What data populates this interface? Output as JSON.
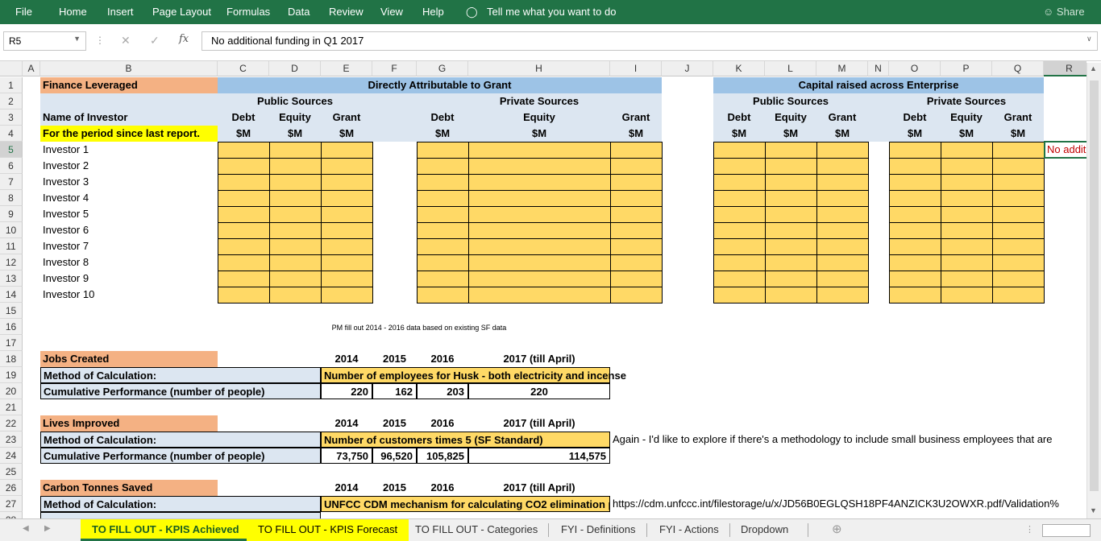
{
  "ribbon": {
    "menu": [
      "File",
      "Home",
      "Insert",
      "Page Layout",
      "Formulas",
      "Data",
      "Review",
      "View",
      "Help"
    ],
    "tell_me": "Tell me what you want to do",
    "share": "Share"
  },
  "formula": {
    "name_box": "R5",
    "value": "No additional funding in Q1 2017"
  },
  "columns": [
    "A",
    "B",
    "C",
    "D",
    "E",
    "F",
    "G",
    "H",
    "I",
    "J",
    "K",
    "L",
    "M",
    "N",
    "O",
    "P",
    "Q",
    "R"
  ],
  "rows": [
    "1",
    "2",
    "3",
    "4",
    "5",
    "6",
    "7",
    "8",
    "9",
    "10",
    "11",
    "12",
    "13",
    "14",
    "15",
    "16",
    "17",
    "18",
    "19",
    "20",
    "21",
    "22",
    "23",
    "24",
    "25",
    "26",
    "27",
    "28"
  ],
  "sheet": {
    "finance_leveraged": "Finance Leveraged",
    "direct_title": "Directly Attributable to Grant",
    "capital_title": "Capital raised across Enterprise",
    "public_sources": "Public Sources",
    "private_sources": "Private Sources",
    "name_of_investor": "Name of Investor",
    "period_label": "For the period since last report.",
    "debt": "Debt",
    "equity": "Equity",
    "grant": "Grant",
    "unit": "$M",
    "investors": [
      "Investor 1",
      "Investor 2",
      "Investor 3",
      "Investor 4",
      "Investor 5",
      "Investor 6",
      "Investor 7",
      "Investor 8",
      "Investor 9",
      "Investor 10"
    ],
    "r5_note": "No additional funding in Q1 2017",
    "pm_note": "PM fill out 2014 - 2016 data based on existing SF data",
    "years": [
      "2014",
      "2015",
      "2016",
      "2017 (till April)"
    ],
    "method_label": "Method of Calculation:",
    "jobs": {
      "title": "Jobs Created",
      "method": "Number of employees for Husk - both electricity and incense",
      "perf_label": "Cumulative Performance (number of people)",
      "values": [
        "220",
        "162",
        "203",
        "220"
      ]
    },
    "lives": {
      "title": "Lives Improved",
      "method": "Number of customers times 5 (SF Standard)",
      "perf_label": "Cumulative Performance (number of people)",
      "values": [
        "73,750",
        "96,520",
        "105,825",
        "114,575"
      ],
      "note": "Again - I'd like to explore if there's a methodology to include small business employees that are"
    },
    "carbon": {
      "title": "Carbon Tonnes Saved",
      "method": "UNFCC CDM mechanism for calculating CO2 elimination p",
      "link": "https://cdm.unfccc.int/filestorage/u/x/JD56B0EGLQSH18PF4ANZICK3U2OWXR.pdf/Validation%"
    }
  },
  "tabs": [
    "TO FILL OUT - KPIS Achieved",
    "TO FILL OUT - KPIS Forecast",
    "TO FILL OUT - Categories",
    "FYI - Definitions",
    "FYI - Actions",
    "Dropdown"
  ],
  "colors": {
    "ribbon": "#217346",
    "header_blue": "#9dc3e6",
    "sub_blue": "#dce6f1",
    "orange": "#f4b183",
    "gold": "#ffd966",
    "highlight": "#ffff00"
  }
}
